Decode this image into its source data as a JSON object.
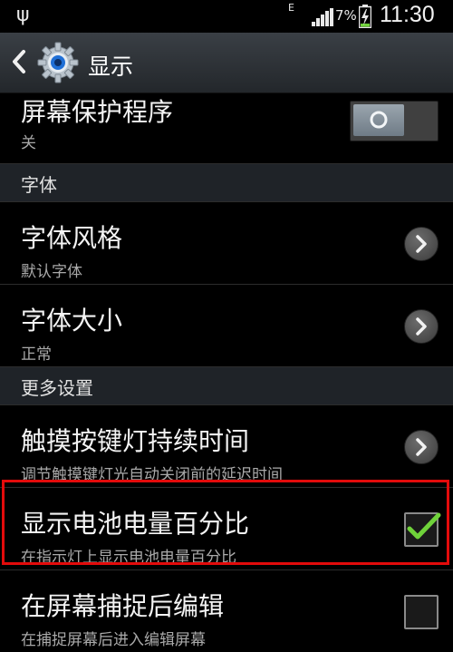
{
  "status_bar": {
    "usb_icon": "usb-icon",
    "network_type": "E",
    "battery_percent": "7%",
    "time": "11:30"
  },
  "action_bar": {
    "title": "显示",
    "back_icon": "back-chevron-icon",
    "app_icon": "settings-gear-icon"
  },
  "rows": {
    "screensaver": {
      "title": "屏幕保护程序",
      "summary": "关",
      "toggle_on": false
    },
    "font_section": "字体",
    "font_style": {
      "title": "字体风格",
      "summary": "默认字体"
    },
    "font_size": {
      "title": "字体大小",
      "summary": "正常"
    },
    "more_section": "更多设置",
    "touch_key_light": {
      "title": "触摸按键灯持续时间",
      "summary": "调节触摸键灯光自动关闭前的延迟时间"
    },
    "battery_percent": {
      "title": "显示电池电量百分比",
      "summary": "在指示灯上显示电池电量百分比",
      "checked": true
    },
    "edit_after_capture": {
      "title": "在屏幕捕捉后编辑",
      "summary": "在捕捉屏幕后进入编辑屏幕",
      "checked": false
    }
  },
  "colors": {
    "highlight": "#e30b0b",
    "check": "#6fd23a",
    "action_bar": "#2f3439"
  }
}
